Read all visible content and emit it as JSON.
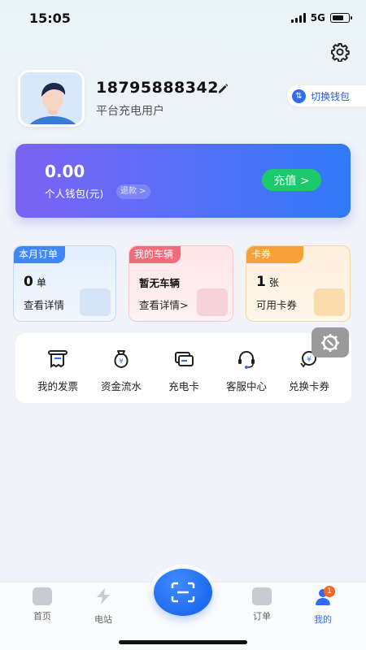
{
  "status": {
    "time": "15:05",
    "network": "5G"
  },
  "profile": {
    "phone": "18795888342",
    "user_type": "平台充电用户",
    "switch_wallet_label": "切换钱包"
  },
  "wallet": {
    "amount": "0.00",
    "label": "个人钱包(元)",
    "refund_label": "退款 >",
    "recharge_label": "充值 >"
  },
  "cards": [
    {
      "tag": "本月订单",
      "value": "0",
      "unit": "单",
      "sub": "查看详情"
    },
    {
      "tag": "我的车辆",
      "value": "暂无车辆",
      "sub": "查看详情>"
    },
    {
      "tag": "卡券",
      "value": "1",
      "unit": "张",
      "sub": "可用卡券"
    }
  ],
  "services": [
    {
      "label": "我的发票",
      "icon": "invoice-icon"
    },
    {
      "label": "资金流水",
      "icon": "money-bag-icon"
    },
    {
      "label": "充电卡",
      "icon": "charge-card-icon"
    },
    {
      "label": "客服中心",
      "icon": "headset-icon"
    },
    {
      "label": "兑换卡券",
      "icon": "exchange-coupon-icon"
    }
  ],
  "tabs": [
    {
      "label": "首页",
      "icon": "home-icon"
    },
    {
      "label": "电站",
      "icon": "station-icon"
    },
    {
      "label": "订单",
      "icon": "order-icon"
    },
    {
      "label": "我的",
      "icon": "profile-icon",
      "active": true,
      "badge": "1"
    }
  ],
  "colors": {
    "accent": "#2f6cf3",
    "recharge": "#1cc96b",
    "badge": "#f5652b"
  }
}
